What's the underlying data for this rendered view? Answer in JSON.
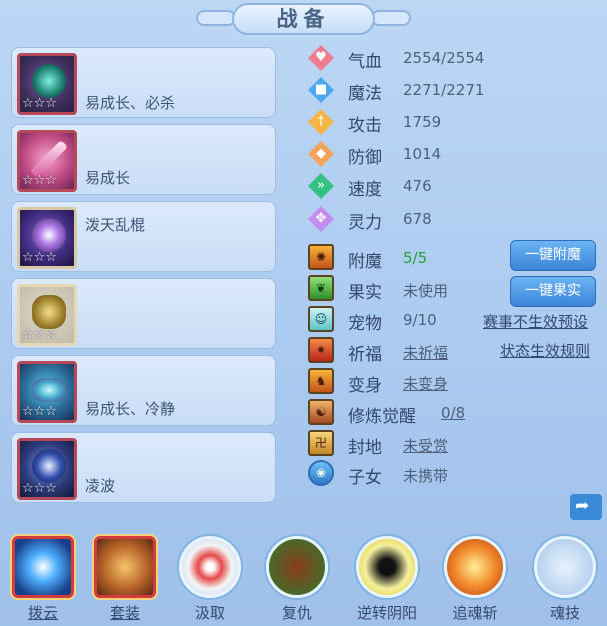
{
  "header": {
    "title": "战备"
  },
  "equipment": [
    {
      "label": "易成长、必杀",
      "stars": "☆☆☆"
    },
    {
      "label": "易成长",
      "stars": "☆☆☆"
    },
    {
      "label": "泼天乱棍",
      "stars": "☆☆☆"
    },
    {
      "label": "",
      "stars": "☆☆☆"
    },
    {
      "label": "易成长、冷静",
      "stars": "☆☆☆"
    },
    {
      "label": "凌波",
      "stars": "☆☆☆"
    }
  ],
  "stats": [
    {
      "name": "气血",
      "value": "2554/2554",
      "icon": "heart-icon",
      "color": "#f07b8e"
    },
    {
      "name": "魔法",
      "value": "2271/2271",
      "icon": "mana-icon",
      "color": "#4aa7f0"
    },
    {
      "name": "攻击",
      "value": "1759",
      "icon": "sword-icon",
      "color": "#f5b544"
    },
    {
      "name": "防御",
      "value": "1014",
      "icon": "shield-icon",
      "color": "#f3a45a"
    },
    {
      "name": "速度",
      "value": "476",
      "icon": "speed-icon",
      "color": "#33c281"
    },
    {
      "name": "灵力",
      "value": "678",
      "icon": "spirit-icon",
      "color": "#c48df0"
    }
  ],
  "info": [
    {
      "name": "附魔",
      "value": "5/5",
      "icon": "enchant-icon"
    },
    {
      "name": "果实",
      "value": "未使用",
      "icon": "fruit-icon"
    },
    {
      "name": "宠物",
      "value": "9/10",
      "icon": "pet-icon"
    },
    {
      "name": "祈福",
      "value": "未祈福",
      "icon": "blessing-icon"
    },
    {
      "name": "变身",
      "value": "未变身",
      "icon": "transform-icon"
    },
    {
      "name": "修炼觉醒",
      "value": "0/8",
      "icon": "cultivation-icon"
    },
    {
      "name": "封地",
      "value": "未受赏",
      "icon": "fief-icon"
    },
    {
      "name": "子女",
      "value": "未携带",
      "icon": "paw-icon"
    }
  ],
  "buttons": {
    "enchant_all": "一键附魔",
    "fruit_all": "一键果实",
    "event_preset": "赛事不生效预设",
    "status_rules": "状态生效规则"
  },
  "skills": [
    {
      "label": "拨云",
      "icon": "cloud-skill-icon"
    },
    {
      "label": "套装",
      "icon": "set-skill-icon"
    },
    {
      "label": "汲取",
      "icon": "absorb-skill-icon"
    },
    {
      "label": "复仇",
      "icon": "revenge-skill-icon"
    },
    {
      "label": "逆转阴阳",
      "icon": "yinyang-skill-icon"
    },
    {
      "label": "追魂斩",
      "icon": "slash-skill-icon"
    },
    {
      "label": "魂技",
      "icon": "soul-skill-icon"
    }
  ]
}
